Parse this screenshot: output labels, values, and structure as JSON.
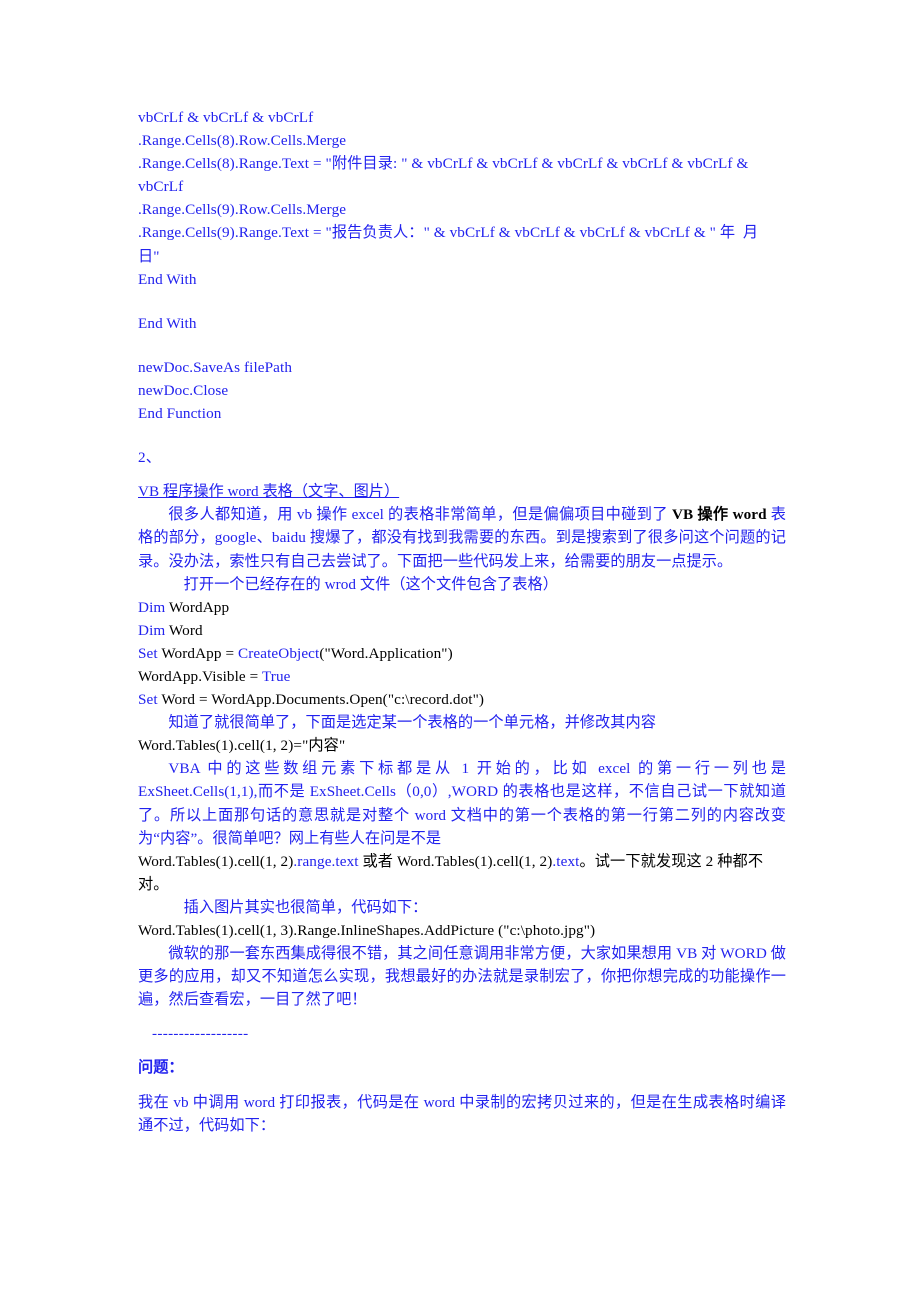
{
  "document": {
    "colors": {
      "text_blue": "#2222ee",
      "text_black": "#000000",
      "background": "#ffffff"
    },
    "code_block_1": [
      "vbCrLf & vbCrLf & vbCrLf",
      ".Range.Cells(8).Row.Cells.Merge",
      ".Range.Cells(8).Range.Text = \"附件目录: \" & vbCrLf & vbCrLf & vbCrLf & vbCrLf & vbCrLf & vbCrLf",
      ".Range.Cells(9).Row.Cells.Merge",
      ".Range.Cells(9).Range.Text = \"报告负责人：\" & vbCrLf & vbCrLf & vbCrLf & vbCrLf & \" 年  月  日\"",
      "End With"
    ],
    "code_block_1b": "End With",
    "code_block_1c": [
      "newDoc.SaveAs filePath",
      "newDoc.Close",
      "End Function"
    ],
    "section_number": "2、",
    "section_heading": "VB 程序操作 word 表格（文字、图片）",
    "para_1_a": "很多人都知道，用 vb 操作 excel 的表格非常简单，但是偏偏项目中碰到了 ",
    "para_1_bold": "VB 操作 word",
    "para_1_b": " 表格的部分，google、baidu 搜爆了，都没有找到我需要的东西。到是搜索到了很多问这个问题的记录。没办法，索性只有自己去尝试了。下面把一些代码发上来，给需要的朋友一点提示。",
    "para_2": "打开一个已经存在的 wrod 文件（这个文件包含了表格）",
    "code_block_2": [
      {
        "kw": "Dim",
        "rest": " WordApp"
      },
      {
        "kw": "Dim",
        "rest": " Word"
      },
      {
        "kw": "Set",
        "rest": " WordApp = ",
        "kw2": "CreateObject",
        "rest2": "(\"Word.Application\")"
      },
      {
        "kw": "",
        "rest": "WordApp.Visible = ",
        "kw2": "True",
        "rest2": ""
      },
      {
        "kw": "Set",
        "rest": " Word = WordApp.Documents.Open(\"c:\\record.dot\")"
      }
    ],
    "para_3": "知道了就很简单了，下面是选定某一个表格的一个单元格，并修改其内容",
    "code_line_1": "Word.Tables(1).cell(1, 2)=\"内容\"",
    "para_4": "VBA 中的这些数组元素下标都是从 1 开始的，比如 excel 的第一行一列也是 ExSheet.Cells(1,1),而不是 ExSheet.Cells（0,0）,WORD 的表格也是这样，不信自己试一下就知道了。所以上面那句话的意思就是对整个 word 文档中的第一个表格的第一行第二列的内容改变为“内容”。很简单吧？网上有些人在问是不是",
    "code_line_2_a": "Word.Tables(1).cell(1, 2)",
    "code_line_2_b": ".range.text",
    "code_line_2_c": " 或者 ",
    "code_line_2_d": "Word.Tables(1).cell(1, 2)",
    "code_line_2_e": ".text",
    "code_line_2_f": "。试一下就发现这 2 种都不对。",
    "para_5": "插入图片其实也很简单，代码如下：",
    "code_line_3": "Word.Tables(1).cell(1, 3).Range.InlineShapes.AddPicture (\"c:\\photo.jpg\")",
    "para_6": "微软的那一套东西集成得很不错，其之间任意调用非常方便，大家如果想用 VB 对 WORD 做更多的应用，却又不知道怎么实现，我想最好的办法就是录制宏了，你把你想完成的功能操作一遍，然后查看宏，一目了然了吧！",
    "separator": "------------------",
    "question_heading": "问题：",
    "para_7": "我在 vb 中调用 word 打印报表，代码是在 word 中录制的宏拷贝过来的，但是在生成表格时编译通不过，代码如下："
  }
}
